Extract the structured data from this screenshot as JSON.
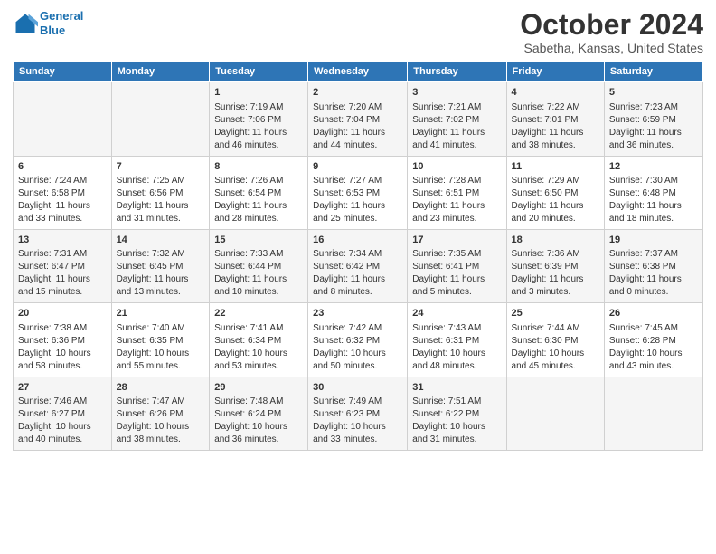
{
  "logo": {
    "line1": "General",
    "line2": "Blue"
  },
  "title": "October 2024",
  "subtitle": "Sabetha, Kansas, United States",
  "days_of_week": [
    "Sunday",
    "Monday",
    "Tuesday",
    "Wednesday",
    "Thursday",
    "Friday",
    "Saturday"
  ],
  "weeks": [
    [
      {
        "num": "",
        "sunrise": "",
        "sunset": "",
        "daylight": ""
      },
      {
        "num": "",
        "sunrise": "",
        "sunset": "",
        "daylight": ""
      },
      {
        "num": "1",
        "sunrise": "Sunrise: 7:19 AM",
        "sunset": "Sunset: 7:06 PM",
        "daylight": "Daylight: 11 hours and 46 minutes."
      },
      {
        "num": "2",
        "sunrise": "Sunrise: 7:20 AM",
        "sunset": "Sunset: 7:04 PM",
        "daylight": "Daylight: 11 hours and 44 minutes."
      },
      {
        "num": "3",
        "sunrise": "Sunrise: 7:21 AM",
        "sunset": "Sunset: 7:02 PM",
        "daylight": "Daylight: 11 hours and 41 minutes."
      },
      {
        "num": "4",
        "sunrise": "Sunrise: 7:22 AM",
        "sunset": "Sunset: 7:01 PM",
        "daylight": "Daylight: 11 hours and 38 minutes."
      },
      {
        "num": "5",
        "sunrise": "Sunrise: 7:23 AM",
        "sunset": "Sunset: 6:59 PM",
        "daylight": "Daylight: 11 hours and 36 minutes."
      }
    ],
    [
      {
        "num": "6",
        "sunrise": "Sunrise: 7:24 AM",
        "sunset": "Sunset: 6:58 PM",
        "daylight": "Daylight: 11 hours and 33 minutes."
      },
      {
        "num": "7",
        "sunrise": "Sunrise: 7:25 AM",
        "sunset": "Sunset: 6:56 PM",
        "daylight": "Daylight: 11 hours and 31 minutes."
      },
      {
        "num": "8",
        "sunrise": "Sunrise: 7:26 AM",
        "sunset": "Sunset: 6:54 PM",
        "daylight": "Daylight: 11 hours and 28 minutes."
      },
      {
        "num": "9",
        "sunrise": "Sunrise: 7:27 AM",
        "sunset": "Sunset: 6:53 PM",
        "daylight": "Daylight: 11 hours and 25 minutes."
      },
      {
        "num": "10",
        "sunrise": "Sunrise: 7:28 AM",
        "sunset": "Sunset: 6:51 PM",
        "daylight": "Daylight: 11 hours and 23 minutes."
      },
      {
        "num": "11",
        "sunrise": "Sunrise: 7:29 AM",
        "sunset": "Sunset: 6:50 PM",
        "daylight": "Daylight: 11 hours and 20 minutes."
      },
      {
        "num": "12",
        "sunrise": "Sunrise: 7:30 AM",
        "sunset": "Sunset: 6:48 PM",
        "daylight": "Daylight: 11 hours and 18 minutes."
      }
    ],
    [
      {
        "num": "13",
        "sunrise": "Sunrise: 7:31 AM",
        "sunset": "Sunset: 6:47 PM",
        "daylight": "Daylight: 11 hours and 15 minutes."
      },
      {
        "num": "14",
        "sunrise": "Sunrise: 7:32 AM",
        "sunset": "Sunset: 6:45 PM",
        "daylight": "Daylight: 11 hours and 13 minutes."
      },
      {
        "num": "15",
        "sunrise": "Sunrise: 7:33 AM",
        "sunset": "Sunset: 6:44 PM",
        "daylight": "Daylight: 11 hours and 10 minutes."
      },
      {
        "num": "16",
        "sunrise": "Sunrise: 7:34 AM",
        "sunset": "Sunset: 6:42 PM",
        "daylight": "Daylight: 11 hours and 8 minutes."
      },
      {
        "num": "17",
        "sunrise": "Sunrise: 7:35 AM",
        "sunset": "Sunset: 6:41 PM",
        "daylight": "Daylight: 11 hours and 5 minutes."
      },
      {
        "num": "18",
        "sunrise": "Sunrise: 7:36 AM",
        "sunset": "Sunset: 6:39 PM",
        "daylight": "Daylight: 11 hours and 3 minutes."
      },
      {
        "num": "19",
        "sunrise": "Sunrise: 7:37 AM",
        "sunset": "Sunset: 6:38 PM",
        "daylight": "Daylight: 11 hours and 0 minutes."
      }
    ],
    [
      {
        "num": "20",
        "sunrise": "Sunrise: 7:38 AM",
        "sunset": "Sunset: 6:36 PM",
        "daylight": "Daylight: 10 hours and 58 minutes."
      },
      {
        "num": "21",
        "sunrise": "Sunrise: 7:40 AM",
        "sunset": "Sunset: 6:35 PM",
        "daylight": "Daylight: 10 hours and 55 minutes."
      },
      {
        "num": "22",
        "sunrise": "Sunrise: 7:41 AM",
        "sunset": "Sunset: 6:34 PM",
        "daylight": "Daylight: 10 hours and 53 minutes."
      },
      {
        "num": "23",
        "sunrise": "Sunrise: 7:42 AM",
        "sunset": "Sunset: 6:32 PM",
        "daylight": "Daylight: 10 hours and 50 minutes."
      },
      {
        "num": "24",
        "sunrise": "Sunrise: 7:43 AM",
        "sunset": "Sunset: 6:31 PM",
        "daylight": "Daylight: 10 hours and 48 minutes."
      },
      {
        "num": "25",
        "sunrise": "Sunrise: 7:44 AM",
        "sunset": "Sunset: 6:30 PM",
        "daylight": "Daylight: 10 hours and 45 minutes."
      },
      {
        "num": "26",
        "sunrise": "Sunrise: 7:45 AM",
        "sunset": "Sunset: 6:28 PM",
        "daylight": "Daylight: 10 hours and 43 minutes."
      }
    ],
    [
      {
        "num": "27",
        "sunrise": "Sunrise: 7:46 AM",
        "sunset": "Sunset: 6:27 PM",
        "daylight": "Daylight: 10 hours and 40 minutes."
      },
      {
        "num": "28",
        "sunrise": "Sunrise: 7:47 AM",
        "sunset": "Sunset: 6:26 PM",
        "daylight": "Daylight: 10 hours and 38 minutes."
      },
      {
        "num": "29",
        "sunrise": "Sunrise: 7:48 AM",
        "sunset": "Sunset: 6:24 PM",
        "daylight": "Daylight: 10 hours and 36 minutes."
      },
      {
        "num": "30",
        "sunrise": "Sunrise: 7:49 AM",
        "sunset": "Sunset: 6:23 PM",
        "daylight": "Daylight: 10 hours and 33 minutes."
      },
      {
        "num": "31",
        "sunrise": "Sunrise: 7:51 AM",
        "sunset": "Sunset: 6:22 PM",
        "daylight": "Daylight: 10 hours and 31 minutes."
      },
      {
        "num": "",
        "sunrise": "",
        "sunset": "",
        "daylight": ""
      },
      {
        "num": "",
        "sunrise": "",
        "sunset": "",
        "daylight": ""
      }
    ]
  ]
}
